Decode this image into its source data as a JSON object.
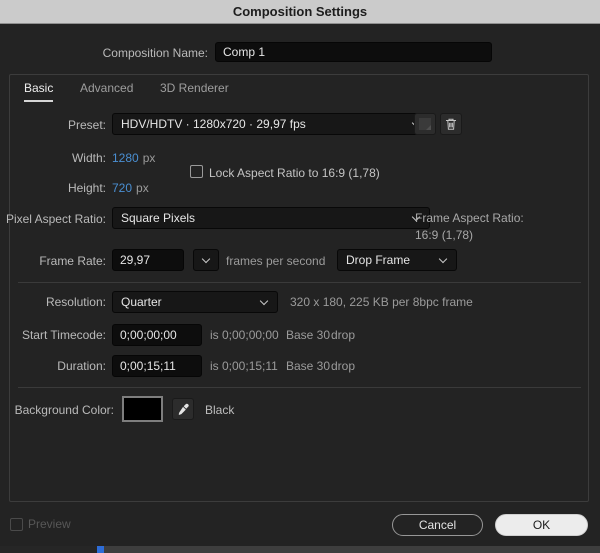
{
  "title_bar": {
    "title": "Composition Settings"
  },
  "composition_name": {
    "label": "Composition Name:",
    "value": "Comp 1"
  },
  "tabs": {
    "basic": "Basic",
    "advanced": "Advanced",
    "renderer_3d": "3D Renderer"
  },
  "basic": {
    "preset": {
      "label": "Preset:",
      "value": "HDV/HDTV · 1280x720 · 29,97 fps"
    },
    "width": {
      "label": "Width:",
      "value": "1280",
      "unit": "px"
    },
    "height": {
      "label": "Height:",
      "value": "720",
      "unit": "px"
    },
    "lock_aspect": {
      "label": "Lock Aspect Ratio to 16:9 (1,78)",
      "checked": false
    },
    "pixel_aspect_ratio": {
      "label": "Pixel Aspect Ratio:",
      "value": "Square Pixels"
    },
    "frame_aspect_ratio": {
      "label": "Frame Aspect Ratio:",
      "value": "16:9 (1,78)"
    },
    "frame_rate": {
      "label": "Frame Rate:",
      "value": "29,97",
      "suffix": "frames per second",
      "timebase": "Drop Frame"
    },
    "resolution": {
      "label": "Resolution:",
      "value": "Quarter",
      "info": "320 x 180, 225 KB per 8bpc frame"
    },
    "start_timecode": {
      "label": "Start Timecode:",
      "value": "0;00;00;00",
      "is_text": "is 0;00;00;00",
      "base_text": "Base 30",
      "drop_text": "drop"
    },
    "duration": {
      "label": "Duration:",
      "value": "0;00;15;11",
      "is_text": "is 0;00;15;11",
      "base_text": "Base 30",
      "drop_text": "drop"
    },
    "background_color": {
      "label": "Background Color:",
      "color_name": "Black"
    }
  },
  "footer": {
    "preview_label": "Preview",
    "cancel_label": "Cancel",
    "ok_label": "OK"
  },
  "icons": {
    "save_preset": "save-preset-icon",
    "delete_preset": "trash-icon",
    "eyedropper": "eyedropper-icon",
    "chevron": "chevron-down-icon",
    "lock_checkbox": "checkbox",
    "preview_checkbox": "checkbox"
  },
  "colors": {
    "title-bar-bg": "#cbcbcb",
    "title-text": "#1d1d1d",
    "dialog-bg": "#232323",
    "panel-border": "#3c3c3c",
    "field-bg": "#0d0d0d",
    "dropdown-bg": "#171717",
    "accent-blue": "#4a8fd2",
    "label-text": "#bababa",
    "dim-text": "#9b9b9b",
    "ok-bg": "#ececec",
    "background-swatch": "#000000",
    "timeline-marker": "#2e6dd8"
  }
}
